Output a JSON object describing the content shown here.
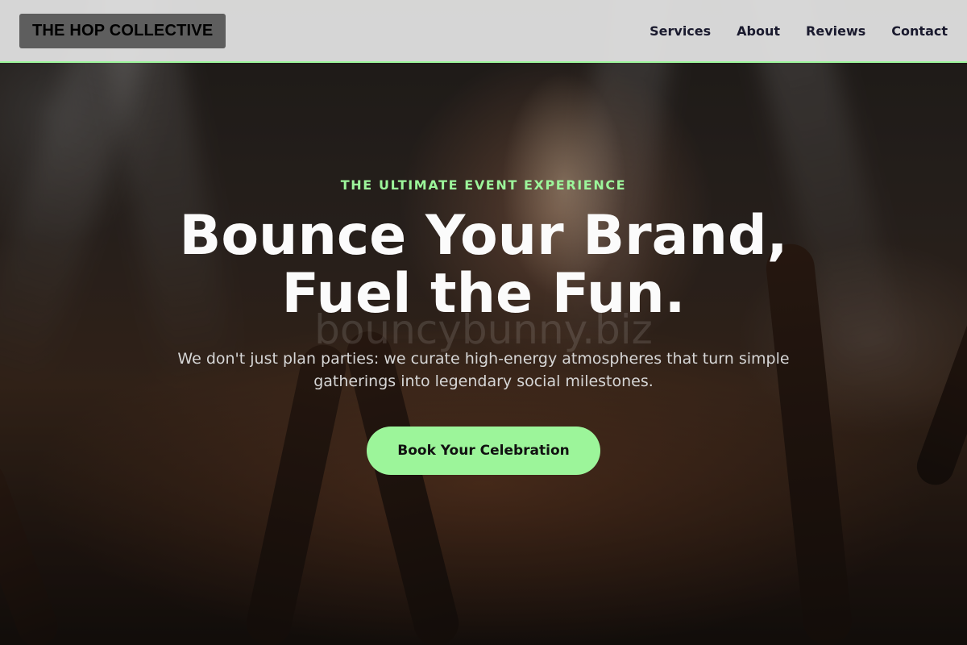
{
  "header": {
    "logo": "THE HOP COLLECTIVE",
    "nav": [
      "Services",
      "About",
      "Reviews",
      "Contact"
    ]
  },
  "hero": {
    "eyebrow": "THE ULTIMATE EVENT EXPERIENCE",
    "headline": "Bounce Your Brand, Fuel the Fun.",
    "watermark": "bouncybunny.biz",
    "subtitle": "We don't just plan parties: we curate high-energy atmospheres that turn simple gatherings into legendary social milestones.",
    "cta": "Book Your Celebration"
  },
  "colors": {
    "accent": "#9cf59a",
    "header_bg": "#dedede",
    "logo_bg": "#5e5e5e"
  }
}
